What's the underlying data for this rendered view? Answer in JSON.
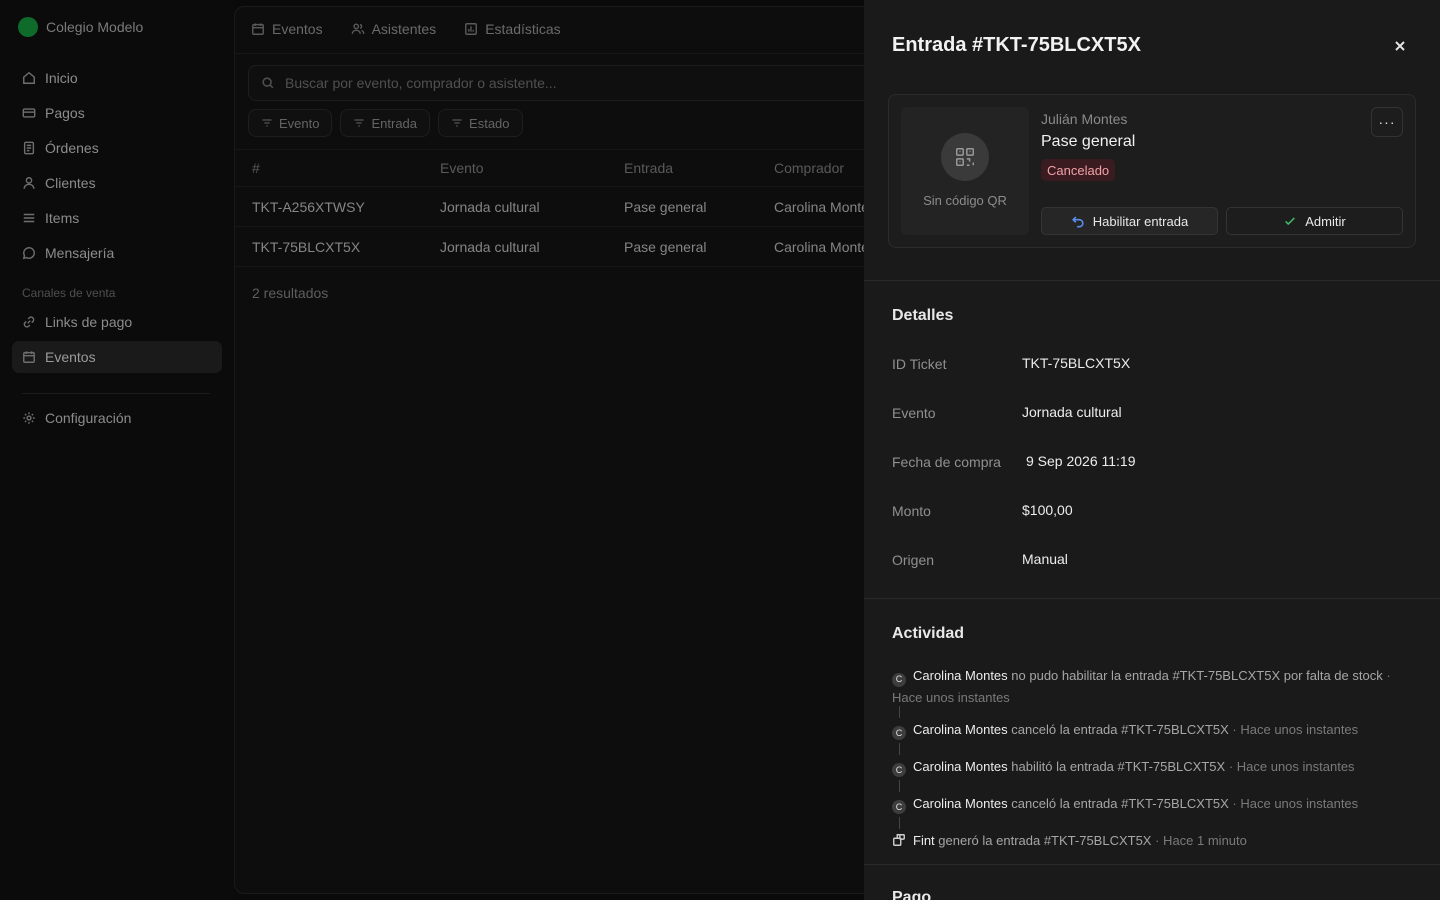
{
  "org": {
    "name": "Colegio Modelo"
  },
  "sidebar": {
    "items": [
      {
        "label": "Inicio",
        "icon": "home-icon"
      },
      {
        "label": "Pagos",
        "icon": "card-icon"
      },
      {
        "label": "Órdenes",
        "icon": "orders-icon"
      },
      {
        "label": "Clientes",
        "icon": "user-icon"
      },
      {
        "label": "Items",
        "icon": "list-icon"
      },
      {
        "label": "Mensajería",
        "icon": "chat-icon"
      }
    ],
    "section_label": "Canales de venta",
    "channel_items": [
      {
        "label": "Links de pago",
        "icon": "link-icon"
      },
      {
        "label": "Eventos",
        "icon": "calendar-icon",
        "active": true
      }
    ],
    "settings_label": "Configuración"
  },
  "main": {
    "tabs": [
      {
        "label": "Eventos"
      },
      {
        "label": "Asistentes"
      },
      {
        "label": "Estadísticas"
      }
    ],
    "search_placeholder": "Buscar por evento, comprador o asistente...",
    "filters": [
      "Evento",
      "Entrada",
      "Estado"
    ],
    "table": {
      "headers": [
        "#",
        "Evento",
        "Entrada",
        "Comprador"
      ],
      "rows": [
        [
          "TKT-A256XTWSY",
          "Jornada cultural",
          "Pase general",
          "Carolina Montes"
        ],
        [
          "TKT-75BLCXT5X",
          "Jornada cultural",
          "Pase general",
          "Carolina Montes"
        ]
      ]
    },
    "results": "2 resultados"
  },
  "drawer": {
    "title": "Entrada #TKT-75BLCXT5X",
    "qr_label": "Sin código QR",
    "holder": "Julián Montes",
    "pass_name": "Pase general",
    "status": "Cancelado",
    "btn_enable": "Habilitar entrada",
    "btn_admit": "Admitir",
    "more_label": "···",
    "details_title": "Detalles",
    "details": [
      {
        "label": "ID Ticket",
        "value": "TKT-75BLCXT5X"
      },
      {
        "label": "Evento",
        "value": "Jornada cultural"
      },
      {
        "label": "Fecha de compra",
        "value": "9 Sep 2026 11:19"
      },
      {
        "label": "Monto",
        "value": "$100,00"
      },
      {
        "label": "Origen",
        "value": "Manual"
      }
    ],
    "activity_title": "Actividad",
    "activity": [
      {
        "initial": "C",
        "who": "Carolina Montes",
        "text": "no pudo habilitar la entrada #TKT-75BLCXT5X por falta de stock",
        "time": "· Hace unos instantes"
      },
      {
        "initial": "C",
        "who": "Carolina Montes",
        "text": "canceló la entrada #TKT-75BLCXT5X",
        "time": "· Hace unos instantes"
      },
      {
        "initial": "C",
        "who": "Carolina Montes",
        "text": "habilitó la entrada #TKT-75BLCXT5X",
        "time": "· Hace unos instantes"
      },
      {
        "initial": "C",
        "who": "Carolina Montes",
        "text": "canceló la entrada #TKT-75BLCXT5X",
        "time": "· Hace unos instantes"
      },
      {
        "initial": "",
        "who": "Fint",
        "text": "generó la entrada #TKT-75BLCXT5X",
        "time": "· Hace 1 minuto"
      }
    ],
    "next_section": "Pago"
  },
  "colors": {
    "accent_green": "#0f6b2a",
    "status_cancelled_bg": "#3a1c20",
    "status_cancelled_text": "#f2a0a8",
    "admit_check": "#3fb96a",
    "enable_arrow": "#5b8def"
  }
}
